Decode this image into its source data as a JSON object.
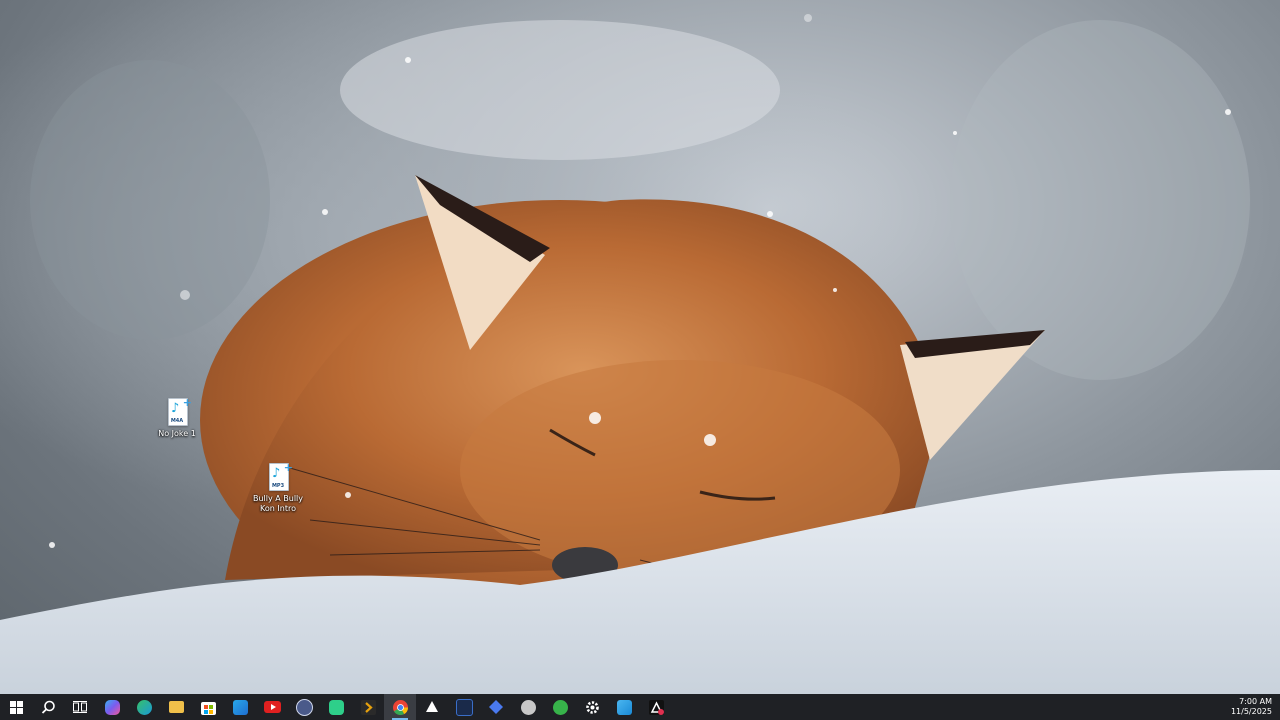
{
  "desktop": {
    "icons": [
      {
        "type": "M4A",
        "label": "No Joke 1"
      },
      {
        "type": "MP3",
        "label": "Bully A Bully Kon Intro"
      }
    ]
  },
  "taskbar": {
    "apps": [
      {
        "icon": "windows-start-icon"
      },
      {
        "icon": "search-icon"
      },
      {
        "icon": "task-view-icon"
      },
      {
        "icon": "copilot-icon",
        "color": "#7a5cf0"
      },
      {
        "icon": "edge-icon",
        "color": "#1a9ad6"
      },
      {
        "icon": "file-explorer-icon",
        "color": "#f0c04a"
      },
      {
        "icon": "microsoft-store-icon",
        "color": "#ffffff"
      },
      {
        "icon": "outlook-icon",
        "color": "#1f6fd1"
      },
      {
        "icon": "youtube-icon",
        "color": "#e02020"
      },
      {
        "icon": "media-app-icon",
        "color": "#4a5a8a"
      },
      {
        "icon": "android-app-icon",
        "color": "#2ecf8a"
      },
      {
        "icon": "plex-icon",
        "color": "#e5a00d"
      },
      {
        "icon": "chrome-icon",
        "color": "#34a853"
      },
      {
        "icon": "unity-icon",
        "color": "#ffffff"
      },
      {
        "icon": "audio-editor-icon",
        "color": "#3a6ec8"
      },
      {
        "icon": "dev-tool-icon",
        "color": "#4a7af0"
      },
      {
        "icon": "disk-icon",
        "color": "#c8c8c8"
      },
      {
        "icon": "upwork-icon",
        "color": "#37b34a"
      },
      {
        "icon": "settings-icon",
        "color": "#ffffff"
      },
      {
        "icon": "photos-icon",
        "color": "#1a8ad6"
      },
      {
        "icon": "capcut-icon",
        "color": "#e03050"
      }
    ],
    "active_index": 12,
    "clock": {
      "time": "7:00 AM",
      "date": "11/5/2025"
    }
  }
}
